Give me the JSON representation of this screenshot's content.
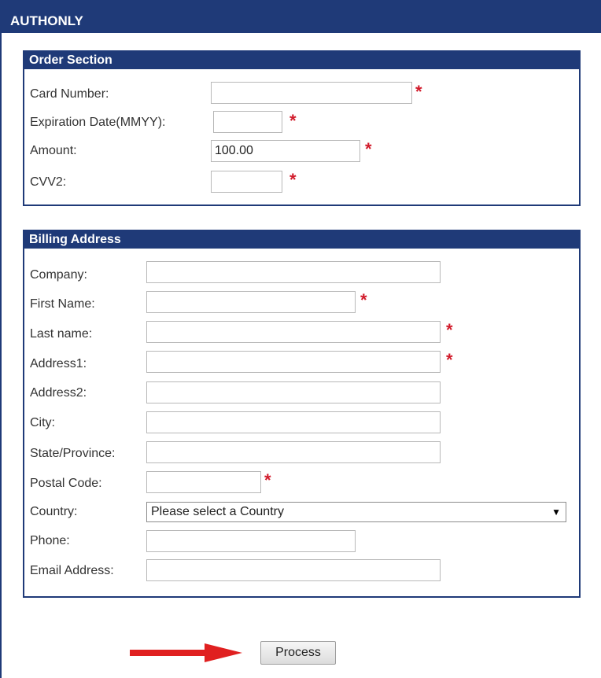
{
  "header": {
    "title": "AUTHONLY"
  },
  "order": {
    "title": "Order Section",
    "card_number_label": "Card Number:",
    "expiration_label": "Expiration Date(MMYY):",
    "amount_label": "Amount:",
    "amount_value": "100.00",
    "cvv_label": "CVV2:"
  },
  "billing": {
    "title": "Billing Address",
    "company_label": "Company:",
    "first_name_label": "First Name:",
    "last_name_label": "Last name:",
    "address1_label": "Address1:",
    "address2_label": "Address2:",
    "city_label": "City:",
    "state_label": "State/Province:",
    "postal_label": "Postal Code:",
    "country_label": "Country:",
    "country_value": "Please select a Country",
    "phone_label": "Phone:",
    "email_label": "Email Address:"
  },
  "required_marker": "*",
  "process_label": "Process",
  "colors": {
    "header_bg": "#1f3a78",
    "required": "#d11a2a",
    "arrow": "#e02020"
  }
}
